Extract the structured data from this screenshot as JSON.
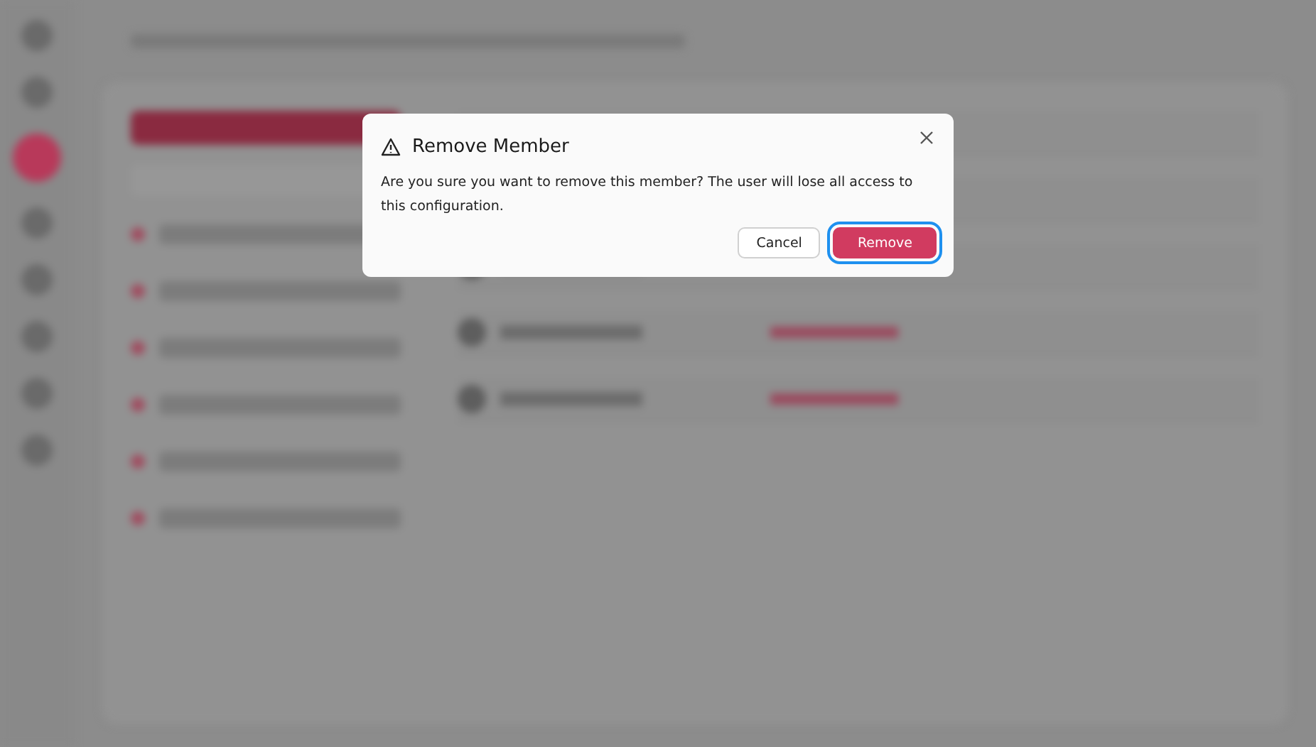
{
  "dialog": {
    "title": "Remove Member",
    "message": "Are you sure you want to remove this member? The user will lose all access to this configuration.",
    "buttons": [
      {
        "label": "Cancel",
        "kind": "secondary",
        "focused": false
      },
      {
        "label": "Remove",
        "kind": "danger",
        "focused": true
      }
    ]
  }
}
